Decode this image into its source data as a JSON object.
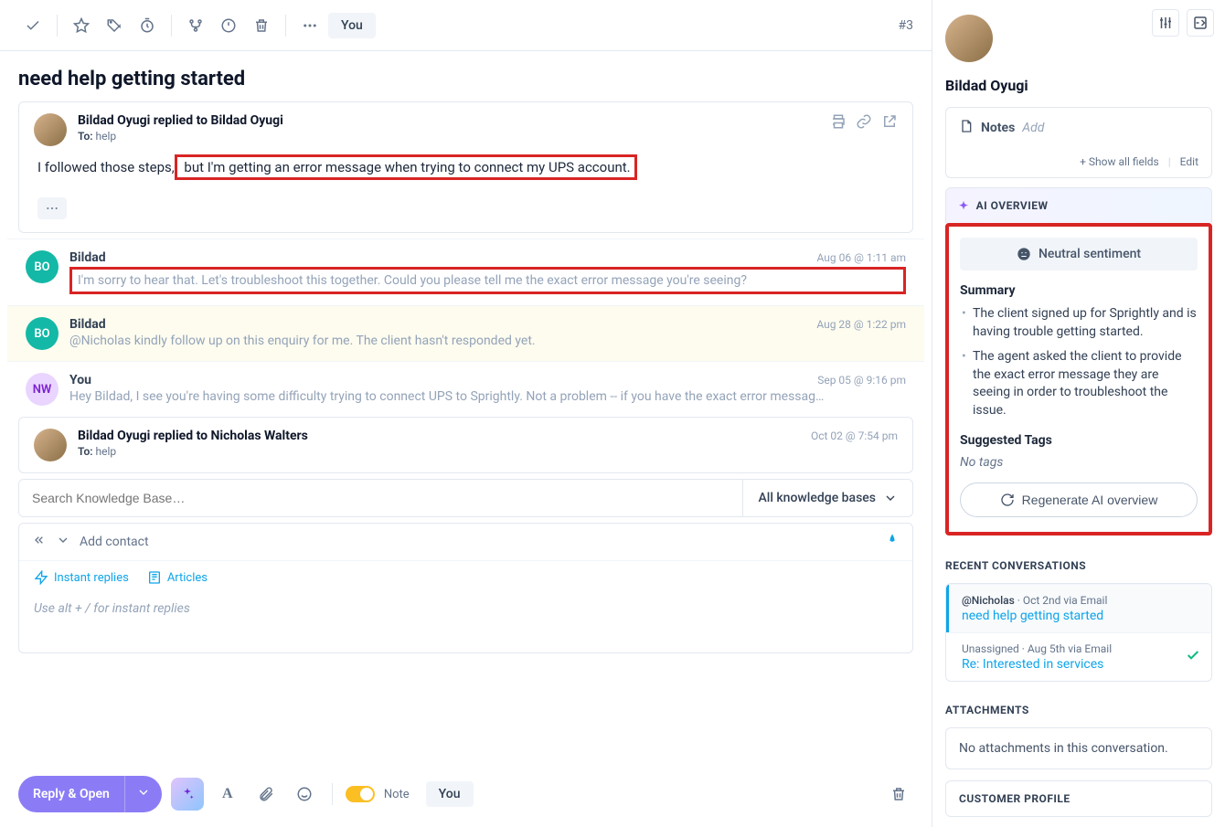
{
  "ticket_id": "#3",
  "toolbar_you": "You",
  "title": "need help getting started",
  "msg1": {
    "from": "Bildad Oyugi replied to Bildad Oyugi",
    "to_label": "To:",
    "to_value": "help",
    "body_pre": "I followed those steps,",
    "body_hl": " but I'm getting an error message when trying to connect my UPS account."
  },
  "msg2": {
    "avatar": "BO",
    "name": "Bildad",
    "time": "Aug 06 @ 1:11 am",
    "body": "I'm sorry to hear that. Let's troubleshoot this together. Could you please tell me the exact error message you're seeing?"
  },
  "msg3": {
    "avatar": "BO",
    "name": "Bildad",
    "time": "Aug 28 @ 1:22 pm",
    "body": "@Nicholas kindly follow up on this enquiry for me. The client hasn't responded yet."
  },
  "msg4": {
    "avatar": "NW",
    "name": "You",
    "time": "Sep 05 @ 9:16 pm",
    "body": "Hey Bildad,   I see you're having some difficulty trying to connect UPS to Sprightly. Not a problem -- if you have the exact error messag…"
  },
  "msg5": {
    "from": "Bildad Oyugi replied to Nicholas Walters",
    "to_label": "To:",
    "to_value": "help",
    "time": "Oct 02 @ 7:54 pm"
  },
  "kb": {
    "placeholder": "Search Knowledge Base…",
    "scope": "All knowledge bases"
  },
  "composer": {
    "add_contact": "Add contact",
    "instant_replies": "Instant replies",
    "articles": "Articles",
    "hint": "Use alt + / for instant replies"
  },
  "bottom": {
    "reply_label": "Reply & Open",
    "note_label": "Note",
    "you": "You"
  },
  "sidebar": {
    "name": "Bildad Oyugi",
    "notes_label": "Notes",
    "notes_add": "Add",
    "show_all": "+ Show all fields",
    "edit": "Edit",
    "ai_overview_h": "AI OVERVIEW",
    "sentiment": "Neutral sentiment",
    "summary_h": "Summary",
    "summary_items": [
      "The client signed up for Sprightly and is having trouble getting started.",
      "The agent asked the client to provide the exact error message they are seeing in order to troubleshoot the issue."
    ],
    "tags_h": "Suggested Tags",
    "no_tags": "No tags",
    "regen": "Regenerate AI overview",
    "recent_h": "RECENT CONVERSATIONS",
    "recent": [
      {
        "assignee": "@Nicholas",
        "meta": " · Oct 2nd via Email",
        "title": "need help getting started"
      },
      {
        "assignee": "Unassigned",
        "meta": " · Aug 5th via Email",
        "title": "Re: Interested in services"
      }
    ],
    "attachments_h": "ATTACHMENTS",
    "attachments_empty": "No attachments in this conversation.",
    "customer_profile_h": "CUSTOMER PROFILE"
  }
}
